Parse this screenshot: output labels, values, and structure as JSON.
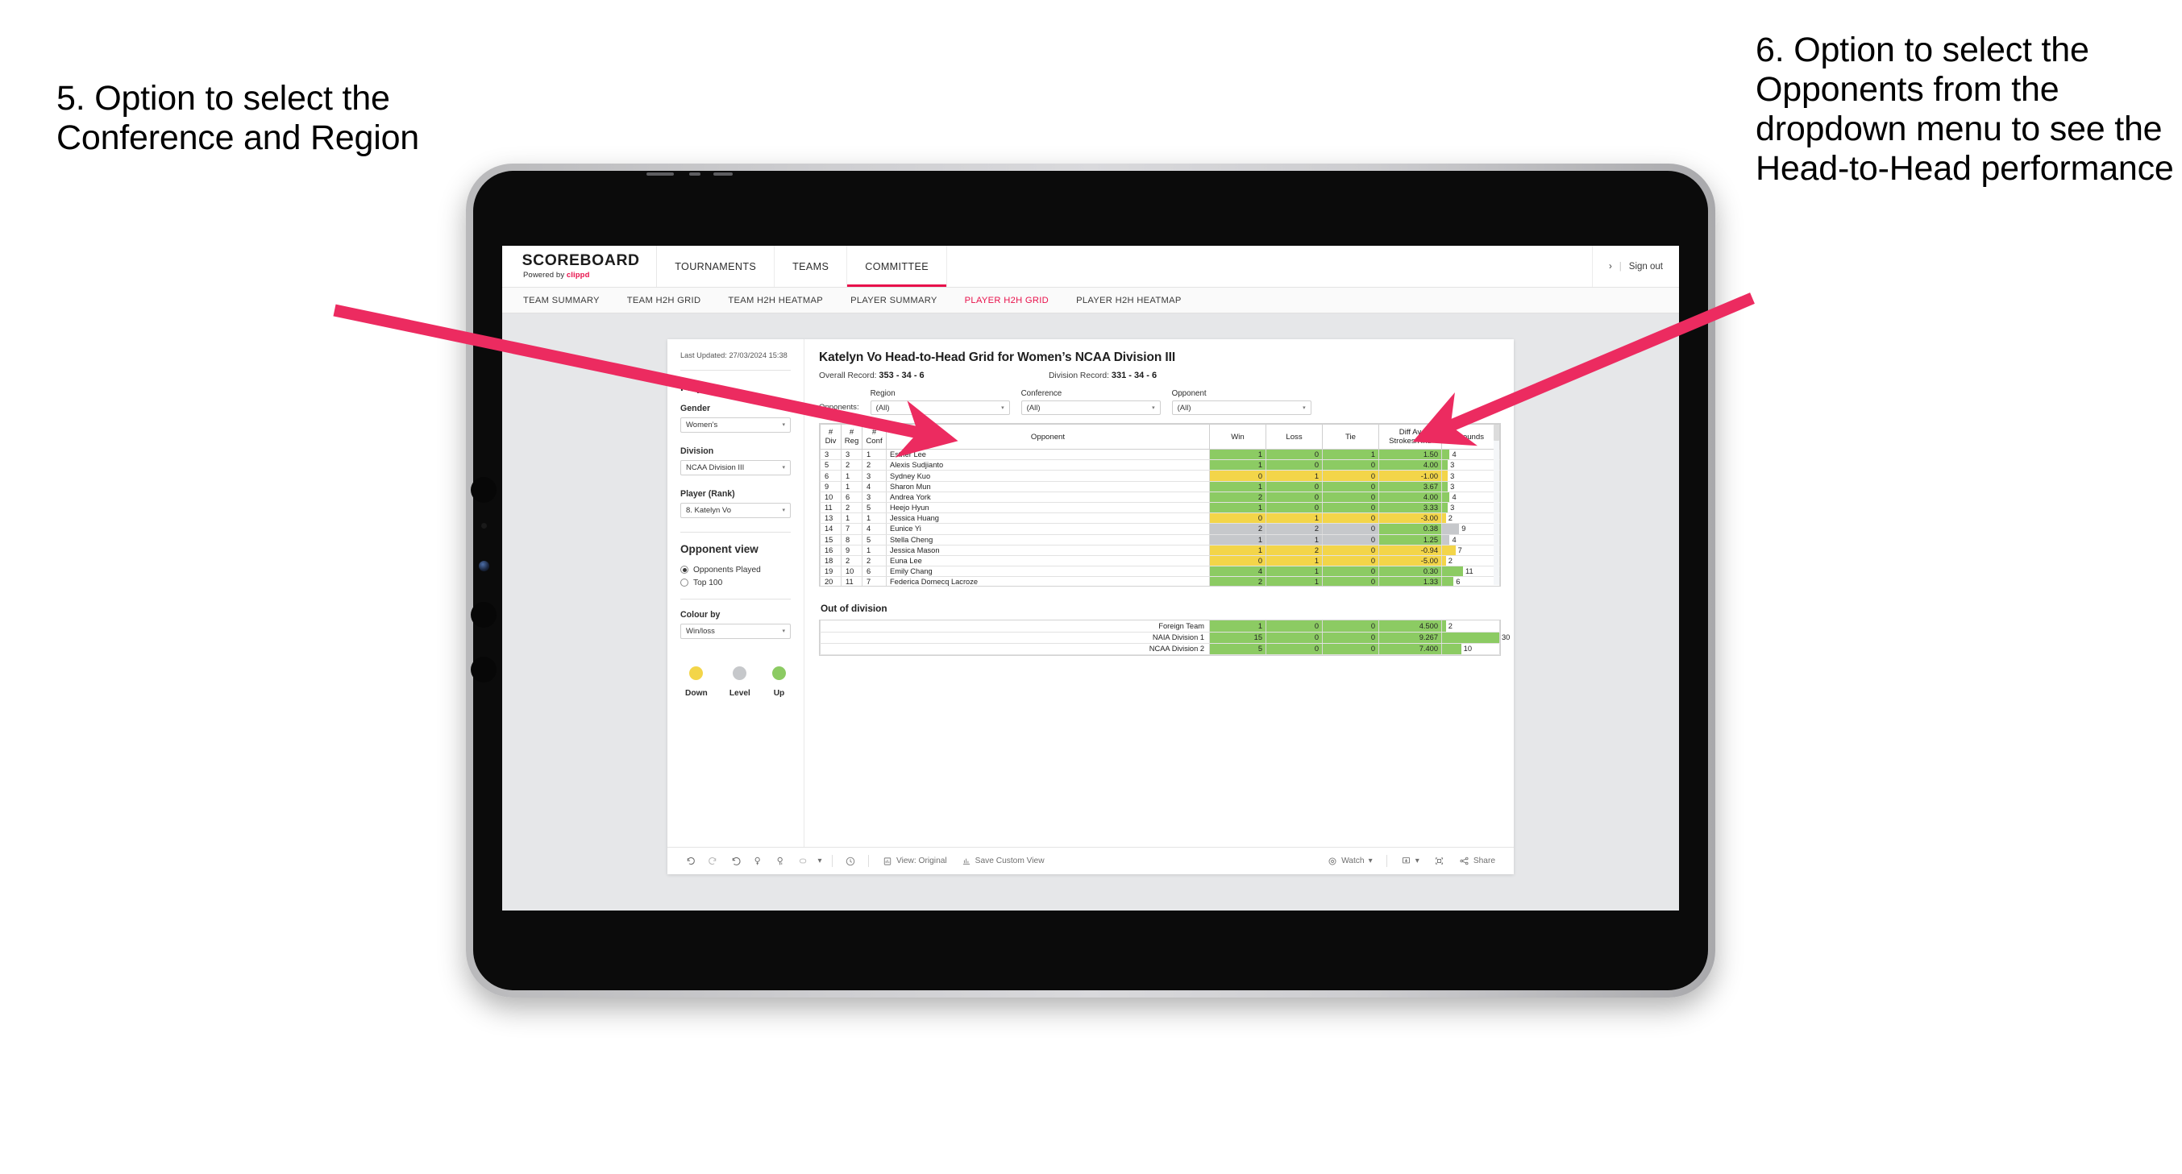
{
  "annotations": {
    "left": "5. Option to select the Conference and Region",
    "right": "6. Option to select the Opponents from the dropdown menu to see the Head-to-Head performance",
    "arrow_color": "#ec2b60"
  },
  "app": {
    "brand": {
      "title": "SCOREBOARD",
      "powered_prefix": "Powered by ",
      "powered_brand": "clippd"
    },
    "topnav": [
      {
        "label": "TOURNAMENTS",
        "active": false
      },
      {
        "label": "TEAMS",
        "active": false
      },
      {
        "label": "COMMITTEE",
        "active": true
      }
    ],
    "topbar_right": {
      "chevron": "›",
      "separator": "|",
      "sign_out": "Sign out"
    },
    "subnav": [
      {
        "label": "TEAM SUMMARY",
        "active": false
      },
      {
        "label": "TEAM H2H GRID",
        "active": false
      },
      {
        "label": "TEAM H2H HEATMAP",
        "active": false
      },
      {
        "label": "PLAYER SUMMARY",
        "active": false
      },
      {
        "label": "PLAYER H2H GRID",
        "active": true
      },
      {
        "label": "PLAYER H2H HEATMAP",
        "active": false
      }
    ]
  },
  "panel": {
    "last_updated": "Last Updated: 27/03/2024 15:38",
    "section_title": "Player",
    "fields": [
      {
        "label": "Gender",
        "value": "Women’s"
      },
      {
        "label": "Division",
        "value": "NCAA Division III"
      },
      {
        "label": "Player (Rank)",
        "value": "8. Katelyn Vo"
      }
    ],
    "opponent_view": {
      "title": "Opponent view",
      "options": [
        {
          "label": "Opponents Played",
          "selected": true
        },
        {
          "label": "Top 100",
          "selected": false
        }
      ]
    },
    "colour_by": {
      "label": "Colour by",
      "value": "Win/loss"
    },
    "legend": [
      {
        "label": "Down",
        "color": "#f3d549"
      },
      {
        "label": "Level",
        "color": "#c6c8cb"
      },
      {
        "label": "Up",
        "color": "#8ccb63"
      }
    ]
  },
  "main": {
    "title": "Katelyn Vo Head-to-Head Grid for Women’s NCAA Division III",
    "overall_record_label": "Overall Record:",
    "overall_record_value": "353 - 34 - 6",
    "division_record_label": "Division Record:",
    "division_record_value": "331 - 34 - 6",
    "opponents_label": "Opponents:",
    "filters": [
      {
        "label": "Region",
        "value": "(All)"
      },
      {
        "label": "Conference",
        "value": "(All)"
      },
      {
        "label": "Opponent",
        "value": "(All)"
      }
    ]
  },
  "chart_data": {
    "type": "table",
    "title": "Katelyn Vo Head-to-Head Grid for Women’s NCAA Division III",
    "columns": [
      "# Div",
      "# Reg",
      "# Conf",
      "Opponent",
      "Win",
      "Loss",
      "Tie",
      "Diff Av Strokes/Rnd",
      "Rounds"
    ],
    "column_headers_split": [
      {
        "l1": "#",
        "l2": "Div"
      },
      {
        "l1": "#",
        "l2": "Reg"
      },
      {
        "l1": "#",
        "l2": "Conf"
      },
      {
        "l1": "Opponent",
        "l2": ""
      },
      {
        "l1": "Win",
        "l2": ""
      },
      {
        "l1": "Loss",
        "l2": ""
      },
      {
        "l1": "Tie",
        "l2": ""
      },
      {
        "l1": "Diff Av",
        "l2": "Strokes/Rnd"
      },
      {
        "l1": "Rounds",
        "l2": ""
      }
    ],
    "rounds_max": 30,
    "rows": [
      {
        "div": "3",
        "reg": "3",
        "conf": "1",
        "opponent": "Esther Lee",
        "win": "1",
        "loss": "0",
        "tie": "1",
        "diff": "1.50",
        "rounds": "4",
        "status": "up"
      },
      {
        "div": "5",
        "reg": "2",
        "conf": "2",
        "opponent": "Alexis Sudjianto",
        "win": "1",
        "loss": "0",
        "tie": "0",
        "diff": "4.00",
        "rounds": "3",
        "status": "up"
      },
      {
        "div": "6",
        "reg": "1",
        "conf": "3",
        "opponent": "Sydney Kuo",
        "win": "0",
        "loss": "1",
        "tie": "0",
        "diff": "-1.00",
        "rounds": "3",
        "status": "down"
      },
      {
        "div": "9",
        "reg": "1",
        "conf": "4",
        "opponent": "Sharon Mun",
        "win": "1",
        "loss": "0",
        "tie": "0",
        "diff": "3.67",
        "rounds": "3",
        "status": "up"
      },
      {
        "div": "10",
        "reg": "6",
        "conf": "3",
        "opponent": "Andrea York",
        "win": "2",
        "loss": "0",
        "tie": "0",
        "diff": "4.00",
        "rounds": "4",
        "status": "up"
      },
      {
        "div": "11",
        "reg": "2",
        "conf": "5",
        "opponent": "Heejo Hyun",
        "win": "1",
        "loss": "0",
        "tie": "0",
        "diff": "3.33",
        "rounds": "3",
        "status": "up"
      },
      {
        "div": "13",
        "reg": "1",
        "conf": "1",
        "opponent": "Jessica Huang",
        "win": "0",
        "loss": "1",
        "tie": "0",
        "diff": "-3.00",
        "rounds": "2",
        "status": "down"
      },
      {
        "div": "14",
        "reg": "7",
        "conf": "4",
        "opponent": "Eunice Yi",
        "win": "2",
        "loss": "2",
        "tie": "0",
        "diff": "0.38",
        "rounds": "9",
        "status": "level",
        "diff_status": "up"
      },
      {
        "div": "15",
        "reg": "8",
        "conf": "5",
        "opponent": "Stella Cheng",
        "win": "1",
        "loss": "1",
        "tie": "0",
        "diff": "1.25",
        "rounds": "4",
        "status": "level",
        "diff_status": "up"
      },
      {
        "div": "16",
        "reg": "9",
        "conf": "1",
        "opponent": "Jessica Mason",
        "win": "1",
        "loss": "2",
        "tie": "0",
        "diff": "-0.94",
        "rounds": "7",
        "status": "down"
      },
      {
        "div": "18",
        "reg": "2",
        "conf": "2",
        "opponent": "Euna Lee",
        "win": "0",
        "loss": "1",
        "tie": "0",
        "diff": "-5.00",
        "rounds": "2",
        "status": "down"
      },
      {
        "div": "19",
        "reg": "10",
        "conf": "6",
        "opponent": "Emily Chang",
        "win": "4",
        "loss": "1",
        "tie": "0",
        "diff": "0.30",
        "rounds": "11",
        "status": "up"
      },
      {
        "div": "20",
        "reg": "11",
        "conf": "7",
        "opponent": "Federica Domecq Lacroze",
        "win": "2",
        "loss": "1",
        "tie": "0",
        "diff": "1.33",
        "rounds": "6",
        "status": "up"
      }
    ]
  },
  "out_of_division": {
    "title": "Out of division",
    "rounds_max": 30,
    "rows": [
      {
        "name": "Foreign Team",
        "win": "1",
        "loss": "0",
        "tie": "0",
        "diff": "4.500",
        "rounds": "2",
        "status": "up"
      },
      {
        "name": "NAIA Division 1",
        "win": "15",
        "loss": "0",
        "tie": "0",
        "diff": "9.267",
        "rounds": "30",
        "status": "up"
      },
      {
        "name": "NCAA Division 2",
        "win": "5",
        "loss": "0",
        "tie": "0",
        "diff": "7.400",
        "rounds": "10",
        "status": "up"
      }
    ]
  },
  "toolbar": {
    "icons": [
      "undo-icon",
      "redo-icon",
      "revert-icon",
      "refresh-icon",
      "pause-icon",
      "shape-icon"
    ],
    "dropdown_caret": "▾",
    "view_label": "View: Original",
    "save_label": "Save Custom View",
    "watch_label": "Watch",
    "share_label": "Share"
  },
  "colors": {
    "accent": "#e8114b",
    "up": "#8ccb63",
    "down": "#f3d549",
    "level": "#c6c8cb",
    "bar_up": "#8ccb63"
  }
}
